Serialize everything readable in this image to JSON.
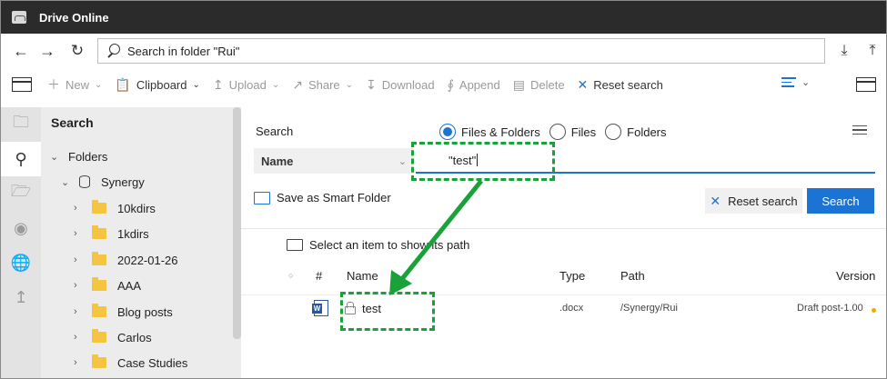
{
  "window": {
    "title": "Drive Online"
  },
  "address": {
    "search_text": "Search in folder \"Rui\""
  },
  "toolbar": {
    "items": [
      {
        "label": "New",
        "icon": "plus-icon",
        "has_menu": true,
        "enabled": false
      },
      {
        "label": "Clipboard",
        "icon": "clipboard-icon",
        "has_menu": true,
        "enabled": true
      },
      {
        "label": "Upload",
        "icon": "upload-icon",
        "has_menu": true,
        "enabled": false
      },
      {
        "label": "Share",
        "icon": "share-icon",
        "has_menu": true,
        "enabled": false
      },
      {
        "label": "Download",
        "icon": "download-icon",
        "has_menu": false,
        "enabled": false
      },
      {
        "label": "Append",
        "icon": "append-icon",
        "has_menu": false,
        "enabled": false
      },
      {
        "label": "Delete",
        "icon": "trash-icon",
        "has_menu": false,
        "enabled": false
      },
      {
        "label": "Reset search",
        "icon": "close-icon",
        "has_menu": false,
        "enabled": true
      }
    ]
  },
  "sidebar": {
    "heading": "Search",
    "tree": {
      "root": "Folders",
      "library": "Synergy",
      "folders": [
        "10kdirs",
        "1kdirs",
        "2022-01-26",
        "AAA",
        "Blog posts",
        "Carlos",
        "Case Studies"
      ]
    }
  },
  "search_panel": {
    "label": "Search",
    "scope_options": [
      {
        "label": "Files & Folders",
        "selected": true
      },
      {
        "label": "Files",
        "selected": false
      },
      {
        "label": "Folders",
        "selected": false
      }
    ],
    "field": "Name",
    "query": "\"test\"",
    "smart_folder_label": "Save as Smart Folder",
    "reset_label": "Reset search",
    "search_label": "Search"
  },
  "results": {
    "hint": "Select an item to show its path",
    "columns": [
      "#",
      "Name",
      "Type",
      "Path",
      "Version"
    ],
    "rows": [
      {
        "name": "test",
        "type": ".docx",
        "path": "/Synergy/Rui",
        "version": "Draft post-1.00"
      }
    ]
  },
  "colors": {
    "accent": "#1b73d4",
    "titlebar": "#2b2b2b",
    "annotation": "#19a23a",
    "folder": "#f5c542"
  }
}
